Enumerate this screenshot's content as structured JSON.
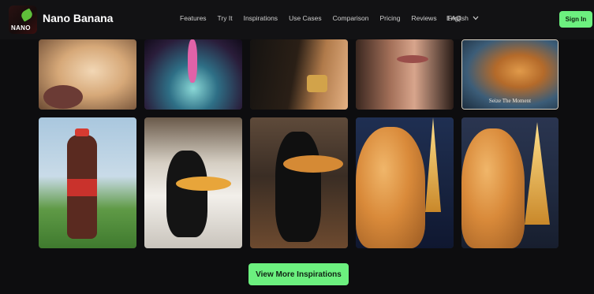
{
  "header": {
    "logo_text": "NANO",
    "brand": "Nano Banana",
    "nav": [
      "Features",
      "Try It",
      "Inspirations",
      "Use Cases",
      "Comparison",
      "Pricing",
      "Reviews",
      "FAQ"
    ],
    "language": "English",
    "sign_in": "Sign In"
  },
  "gallery": {
    "row1": [
      {
        "name": "fluffy-cat-photo"
      },
      {
        "name": "cosmic-figure-photo"
      },
      {
        "name": "jewelry-hand-photo"
      },
      {
        "name": "woman-portrait-photo"
      },
      {
        "name": "cat-headphones-photo",
        "caption": "Seize The Moment"
      }
    ],
    "row2": [
      {
        "name": "knitted-bottle-photo"
      },
      {
        "name": "cat-waiter-burger-photo"
      },
      {
        "name": "cat-waiter-restaurant-photo"
      },
      {
        "name": "cat-eiffel-selfie-photo"
      },
      {
        "name": "cat-eiffel-selfie-photo-2"
      }
    ]
  },
  "cta": {
    "label": "View More Inspirations"
  },
  "colors": {
    "accent": "#6cf07f",
    "background": "#0d0d0f"
  }
}
